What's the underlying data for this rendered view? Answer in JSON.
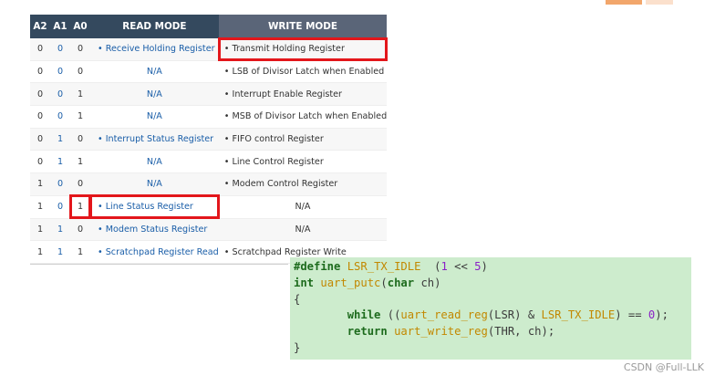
{
  "table": {
    "headers": [
      "A2",
      "A1",
      "A0",
      "READ MODE",
      "WRITE MODE"
    ],
    "rows": [
      {
        "a2": "0",
        "a1": "0",
        "a0": "0",
        "read": "• Receive Holding Register",
        "write": "• Transmit Holding Register"
      },
      {
        "a2": "0",
        "a1": "0",
        "a0": "0",
        "read": "N/A",
        "write": "• LSB of Divisor Latch when Enabled"
      },
      {
        "a2": "0",
        "a1": "0",
        "a0": "1",
        "read": "N/A",
        "write": "• Interrupt Enable Register"
      },
      {
        "a2": "0",
        "a1": "0",
        "a0": "1",
        "read": "N/A",
        "write": "• MSB of Divisor Latch when Enabled"
      },
      {
        "a2": "0",
        "a1": "1",
        "a0": "0",
        "read": "• Interrupt Status Register",
        "write": "• FIFO control Register"
      },
      {
        "a2": "0",
        "a1": "1",
        "a0": "1",
        "read": "N/A",
        "write": "• Line Control Register"
      },
      {
        "a2": "1",
        "a1": "0",
        "a0": "0",
        "read": "N/A",
        "write": "• Modem Control Register"
      },
      {
        "a2": "1",
        "a1": "0",
        "a0": "1",
        "read": "• Line Status Register",
        "write": "N/A"
      },
      {
        "a2": "1",
        "a1": "1",
        "a0": "0",
        "read": "• Modem Status Register",
        "write": "N/A"
      },
      {
        "a2": "1",
        "a1": "1",
        "a0": "1",
        "read": "• Scratchpad Register Read",
        "write": "• Scratchpad Register Write"
      }
    ]
  },
  "code": {
    "l1": {
      "kw": "#define",
      "mac": "LSR_TX_IDLE",
      "open": "(",
      "num": "1",
      "op": " << ",
      "num2": "5",
      "close": ")"
    },
    "l2": {
      "kw": "int",
      "fn": "uart_putc",
      "open": "(",
      "kw2": "char",
      "arg": " ch)"
    },
    "l3": {
      "text": "{"
    },
    "l4": {
      "kw": "while",
      "p1": " ((",
      "fn": "uart_read_reg",
      "p2": "(LSR) & ",
      "mac": "LSR_TX_IDLE",
      "p3": ") == ",
      "num": "0",
      "p4": ");"
    },
    "l5": {
      "kw": "return",
      "fn": "uart_write_reg",
      "p1": "(THR, ch);"
    },
    "l6": {
      "text": "}"
    }
  },
  "watermark": "CSDN @Full-LLK",
  "colors": {
    "header": "#34495e",
    "highlight": "#e3161b",
    "code_bg": "#cdeccd",
    "link_blue": "#1a5ea8"
  }
}
